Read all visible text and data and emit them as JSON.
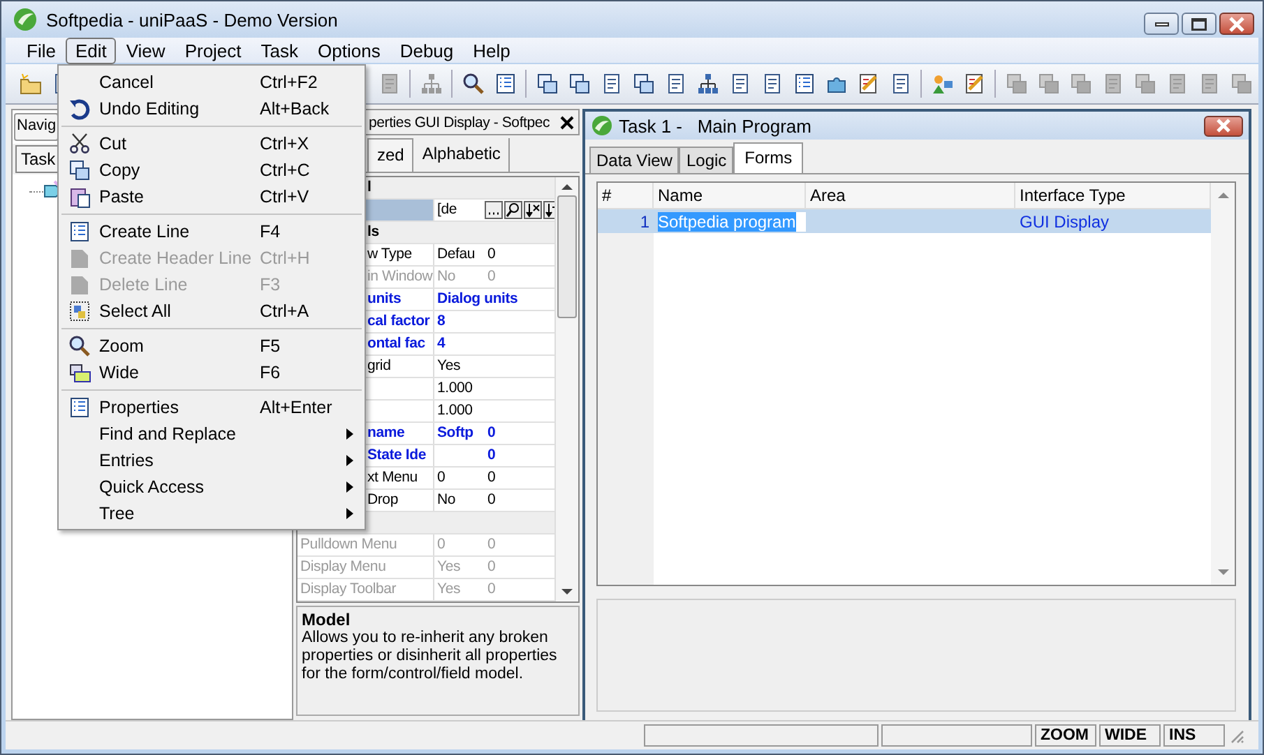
{
  "window": {
    "title": "Softpedia - uniPaaS - Demo Version"
  },
  "menubar": [
    {
      "label": "File",
      "selected": false
    },
    {
      "label": "Edit",
      "selected": true
    },
    {
      "label": "View",
      "selected": false
    },
    {
      "label": "Project",
      "selected": false
    },
    {
      "label": "Task",
      "selected": false
    },
    {
      "label": "Options",
      "selected": false
    },
    {
      "label": "Debug",
      "selected": false
    },
    {
      "label": "Help",
      "selected": false
    }
  ],
  "toolbar": {
    "groups": [
      [
        {
          "disabled": false
        },
        {
          "disabled": false
        }
      ],
      [
        {
          "disabled": true
        }
      ],
      [
        {
          "disabled": true
        }
      ],
      [
        {
          "disabled": false
        },
        {
          "disabled": false
        }
      ],
      [
        {
          "disabled": false
        },
        {
          "disabled": false
        },
        {
          "disabled": false
        },
        {
          "disabled": false
        },
        {
          "disabled": false
        },
        {
          "disabled": false
        },
        {
          "disabled": false
        },
        {
          "disabled": false
        },
        {
          "disabled": false
        },
        {
          "disabled": false
        },
        {
          "disabled": false
        },
        {
          "disabled": false
        }
      ],
      [
        {
          "disabled": false
        },
        {
          "disabled": false
        }
      ],
      [
        {
          "disabled": true
        },
        {
          "disabled": true
        },
        {
          "disabled": true
        },
        {
          "disabled": true
        },
        {
          "disabled": true
        },
        {
          "disabled": true
        },
        {
          "disabled": true
        },
        {
          "disabled": true
        }
      ]
    ]
  },
  "edit_menu": {
    "items": [
      {
        "kind": "item",
        "label": "Cancel",
        "shortcut": "Ctrl+F2",
        "disabled": false,
        "submenu": false
      },
      {
        "kind": "item",
        "label": "Undo Editing",
        "shortcut": "Alt+Back",
        "disabled": false,
        "submenu": false
      },
      {
        "kind": "separator"
      },
      {
        "kind": "item",
        "label": "Cut",
        "shortcut": "Ctrl+X",
        "disabled": false,
        "submenu": false
      },
      {
        "kind": "item",
        "label": "Copy",
        "shortcut": "Ctrl+C",
        "disabled": false,
        "submenu": false
      },
      {
        "kind": "item",
        "label": "Paste",
        "shortcut": "Ctrl+V",
        "disabled": false,
        "submenu": false
      },
      {
        "kind": "separator"
      },
      {
        "kind": "item",
        "label": "Create Line",
        "shortcut": "F4",
        "disabled": false,
        "submenu": false
      },
      {
        "kind": "item",
        "label": "Create Header Line",
        "shortcut": "Ctrl+H",
        "disabled": true,
        "submenu": false
      },
      {
        "kind": "item",
        "label": "Delete Line",
        "shortcut": "F3",
        "disabled": true,
        "submenu": false
      },
      {
        "kind": "item",
        "label": "Select All",
        "shortcut": "Ctrl+A",
        "disabled": false,
        "submenu": false
      },
      {
        "kind": "separator"
      },
      {
        "kind": "item",
        "label": "Zoom",
        "shortcut": "F5",
        "disabled": false,
        "submenu": false
      },
      {
        "kind": "item",
        "label": "Wide",
        "shortcut": "F6",
        "disabled": false,
        "submenu": false
      },
      {
        "kind": "separator"
      },
      {
        "kind": "item",
        "label": "Properties",
        "shortcut": "Alt+Enter",
        "disabled": false,
        "submenu": false
      },
      {
        "kind": "item",
        "label": "Find and Replace",
        "disabled": false,
        "submenu": true
      },
      {
        "kind": "item",
        "label": "Entries",
        "disabled": false,
        "submenu": true
      },
      {
        "kind": "item",
        "label": "Quick Access",
        "disabled": false,
        "submenu": true
      },
      {
        "kind": "item",
        "label": "Tree",
        "disabled": false,
        "submenu": true
      }
    ]
  },
  "navigator": {
    "combo": "Navig",
    "tabs": [
      {
        "label": "Task",
        "selected": true
      }
    ]
  },
  "properties": {
    "title": "perties GUI Display - Softpec",
    "tabs": [
      {
        "label": "zed",
        "selected": true
      },
      {
        "label": "Alphabetic",
        "selected": false
      }
    ],
    "rows": [
      {
        "kind": "category",
        "name": "l"
      },
      {
        "kind": "picker",
        "value": "[de",
        "selected": true,
        "disabled": false,
        "changed": false
      },
      {
        "kind": "category",
        "name": "ls"
      },
      {
        "kind": "property",
        "name": "w Type",
        "value": "Defau",
        "column_3": "0",
        "selected": false,
        "disabled": false,
        "changed": false
      },
      {
        "kind": "property",
        "name": "in Window",
        "value": "No",
        "column_3": "0",
        "selected": false,
        "disabled": true,
        "changed": false
      },
      {
        "kind": "property",
        "name": "units",
        "value": "Dialog units",
        "selected": false,
        "disabled": false,
        "changed": true
      },
      {
        "kind": "property",
        "name": "cal factor",
        "value": "8",
        "selected": false,
        "disabled": false,
        "changed": true
      },
      {
        "kind": "property",
        "name": "ontal fac",
        "value": "4",
        "selected": false,
        "disabled": false,
        "changed": true
      },
      {
        "kind": "property",
        "name": "grid",
        "value": "Yes",
        "selected": false,
        "disabled": false,
        "changed": false
      },
      {
        "kind": "property",
        "value": "1.000",
        "selected": false,
        "disabled": false,
        "changed": false
      },
      {
        "kind": "property",
        "value": "1.000",
        "selected": false,
        "disabled": false,
        "changed": false
      },
      {
        "kind": "property",
        "name": "name",
        "value": "Softp",
        "column_3": "0",
        "selected": false,
        "disabled": false,
        "changed": true
      },
      {
        "kind": "property",
        "name": "State Ide",
        "column_3": "0",
        "selected": false,
        "disabled": false,
        "changed": true
      },
      {
        "kind": "property",
        "name": "xt Menu",
        "value": "0",
        "column_3": "0",
        "selected": false,
        "disabled": false,
        "changed": false
      },
      {
        "kind": "property",
        "name": "Drop",
        "value": "No",
        "column_3": "0",
        "selected": false,
        "disabled": false,
        "changed": false
      },
      {
        "kind": "category"
      },
      {
        "kind": "property",
        "name": "Pulldown Menu",
        "value": "0",
        "column_3": "0",
        "selected": false,
        "disabled": true,
        "changed": false
      },
      {
        "kind": "property",
        "name": "Display Menu",
        "value": "Yes",
        "column_3": "0",
        "selected": false,
        "disabled": true,
        "changed": false
      },
      {
        "kind": "property",
        "name": "Display Toolbar",
        "value": "Yes",
        "column_3": "0",
        "selected": false,
        "disabled": true,
        "changed": false
      }
    ],
    "description": {
      "title": "Model",
      "text": "Allows you to re-inherit any broken properties or disinherit all properties for the form/control/field model."
    }
  },
  "task_window": {
    "title": "Task 1 -   Main Program",
    "tabs": [
      {
        "label": "Data View",
        "selected": false
      },
      {
        "label": "Logic",
        "selected": false
      },
      {
        "label": "Forms",
        "selected": true
      }
    ],
    "table": {
      "columns": [
        "#",
        "Name",
        "Area",
        "Interface Type"
      ],
      "rows": [
        {
          "number": "1",
          "name": "Softpedia program",
          "interface_type": "GUI Display",
          "selected": true,
          "editing": true
        }
      ]
    }
  },
  "status_bar": {
    "indicators": [
      "ZOOM",
      "WIDE",
      "INS"
    ]
  }
}
